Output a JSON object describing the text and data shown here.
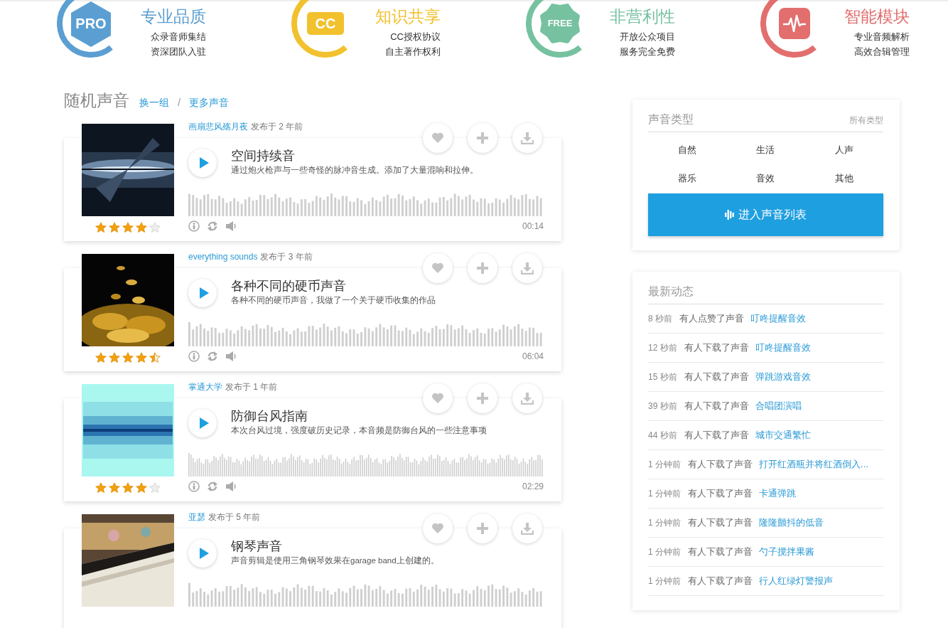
{
  "features": [
    {
      "kind": "hexagon",
      "badge": "PRO",
      "title": "专业品质",
      "lines": [
        "众录音师集结",
        "资深团队入驻"
      ],
      "color": "#5b9fd2"
    },
    {
      "kind": "rounded-rect",
      "badge": "CC",
      "title": "知识共享",
      "lines": [
        "CC授权协议",
        "自主著作权利"
      ],
      "color": "#f2c12e"
    },
    {
      "kind": "flower",
      "badge": "FREE",
      "title": "非营利性",
      "lines": [
        "开放公众项目",
        "服务完全免费"
      ],
      "color": "#76c1a0"
    },
    {
      "kind": "pulse",
      "title": "智能模块",
      "lines": [
        "专业音频解析",
        "高效合辑管理"
      ],
      "color": "#e26e6e"
    }
  ],
  "section": {
    "title": "随机声音",
    "links": [
      "换一组",
      "更多声音"
    ],
    "separator": "/"
  },
  "items": [
    {
      "author": "画扇悲风殇月夜",
      "published": "发布于 2 年前",
      "title": "空间持续音",
      "description": "通过炮火枪声与一些奇怪的脉冲音生成。添加了大量混响和拉伸。",
      "stars": 4,
      "duration": "00:14"
    },
    {
      "author": "everything sounds",
      "published": "发布于 3 年前",
      "title": "各种不同的硬币声音",
      "description": "各种不同的硬币声音，我做了一个关于硬币收集的作品",
      "stars": 4.5,
      "duration": "06:04"
    },
    {
      "author": "掌通大学",
      "published": "发布于 1 年前",
      "title": "防御台风指南",
      "description": "本次台风过境，强度破历史记录，本音频是防御台风的一些注意事项",
      "stars": 4,
      "duration": "02:29"
    },
    {
      "author": "亚瑟",
      "published": "发布于 5 年前",
      "title": "钢琴声音",
      "description": "声音剪辑是使用三角钢琴效果在garage band上创建的。"
    }
  ],
  "types_panel": {
    "title": "声音类型",
    "link": "所有类型",
    "types": [
      "自然",
      "生活",
      "人声",
      "器乐",
      "音效",
      "其他"
    ],
    "button": "进入声音列表"
  },
  "activity_panel": {
    "title": "最新动态",
    "rows": [
      {
        "time": "8 秒前",
        "action": "有人点赞了声音",
        "sound": "叮咚提醒音效"
      },
      {
        "time": "12 秒前",
        "action": "有人下载了声音",
        "sound": "叮咚提醒音效"
      },
      {
        "time": "15 秒前",
        "action": "有人下载了声音",
        "sound": "弹跳游戏音效"
      },
      {
        "time": "39 秒前",
        "action": "有人下载了声音",
        "sound": "合唱团演唱"
      },
      {
        "time": "44 秒前",
        "action": "有人下载了声音",
        "sound": "城市交通繁忙"
      },
      {
        "time": "1 分钟前",
        "action": "有人下载了声音",
        "sound": "打开红酒瓶并将红酒倒入..."
      },
      {
        "time": "1 分钟前",
        "action": "有人下载了声音",
        "sound": "卡通弹跳"
      },
      {
        "time": "1 分钟前",
        "action": "有人下载了声音",
        "sound": "隆隆颤抖的低音"
      },
      {
        "time": "1 分钟前",
        "action": "有人下载了声音",
        "sound": "勺子搅拌果酱"
      },
      {
        "time": "1 分钟前",
        "action": "有人下载了声音",
        "sound": "行人红绿灯警报声"
      }
    ]
  }
}
